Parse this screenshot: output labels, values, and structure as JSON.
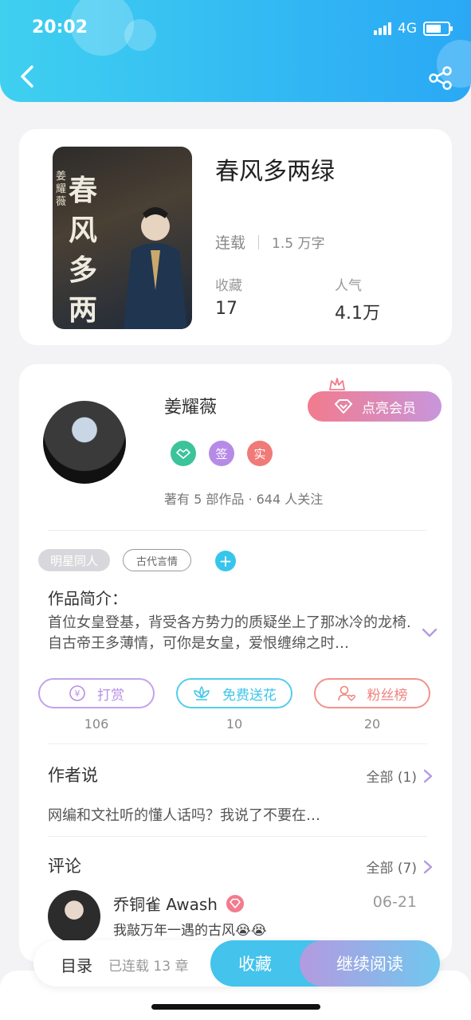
{
  "status_bar": {
    "time": "20:02",
    "network": "4G"
  },
  "nav": {
    "back_icon": "back-chevron-icon",
    "share_icon": "share-icon"
  },
  "book": {
    "title": "春风多两绿",
    "cover_title": "春风多两绿",
    "cover_author": "姜耀薇",
    "status": "连载",
    "word_count": "1.5 万字",
    "collect_label": "收藏",
    "collect_value": "17",
    "popularity_label": "人气",
    "popularity_value": "4.1万"
  },
  "author": {
    "name": "姜耀薇",
    "vip_button": "点亮会员",
    "badges": [
      {
        "icon": "handshake-icon",
        "color": "#3cc39a"
      },
      {
        "text": "签",
        "color": "#b68be8"
      },
      {
        "text": "实",
        "color": "#f07a78"
      }
    ],
    "works_info": "著有 5 部作品 · 644 人关注"
  },
  "tags": [
    "明星同人",
    "古代言情"
  ],
  "intro": {
    "heading": "作品简介：",
    "text": "首位女皇登基，背受各方势力的质疑坐上了那冰冷的龙椅.自古帝王多薄情，可你是女皇，爱恨缠绵之时…"
  },
  "actions": [
    {
      "label": "打赏",
      "count": "106",
      "icon": "yen-coin-icon",
      "color": "#b98ee6"
    },
    {
      "label": "免费送花",
      "count": "10",
      "icon": "lotus-flower-icon",
      "color": "#3dc6ea"
    },
    {
      "label": "粉丝榜",
      "count": "20",
      "icon": "user-heart-icon",
      "color": "#f0827c"
    }
  ],
  "author_says": {
    "heading": "作者说",
    "more": "全部 (1)",
    "text": "网编和文社听的懂人话吗？我说了不要在…"
  },
  "comments": {
    "heading": "评论",
    "more": "全部 (7)",
    "items": [
      {
        "user": "乔铜雀 Awash",
        "date": "06-21",
        "text": "我敲万年一遇的古风😭😭"
      }
    ]
  },
  "bottom_bar": {
    "toc": "目录",
    "chapters": "已连载 13 章",
    "collect": "收藏",
    "read": "继续阅读"
  },
  "colors": {
    "header_start": "#3fd0f0",
    "header_end": "#2aa8f5",
    "accent_blue": "#44c3ec",
    "accent_purple": "#b49ae0"
  }
}
